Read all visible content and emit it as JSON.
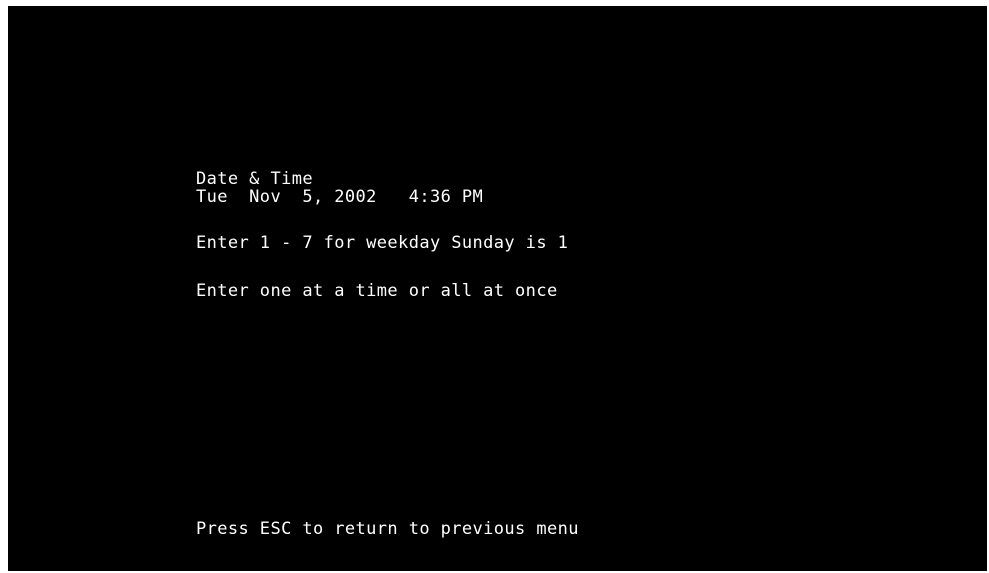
{
  "screen": {
    "title": "Date & Time",
    "current_datetime": "Tue  Nov  5, 2002   4:36 PM",
    "instruction_weekday": "Enter 1 - 7 for weekday Sunday is 1",
    "instruction_entry": "Enter one at a time or all at once",
    "footer_hint": "Press ESC to return to previous menu"
  },
  "colors": {
    "background": "#000000",
    "text": "#ffffff",
    "border": "#ffffff"
  }
}
